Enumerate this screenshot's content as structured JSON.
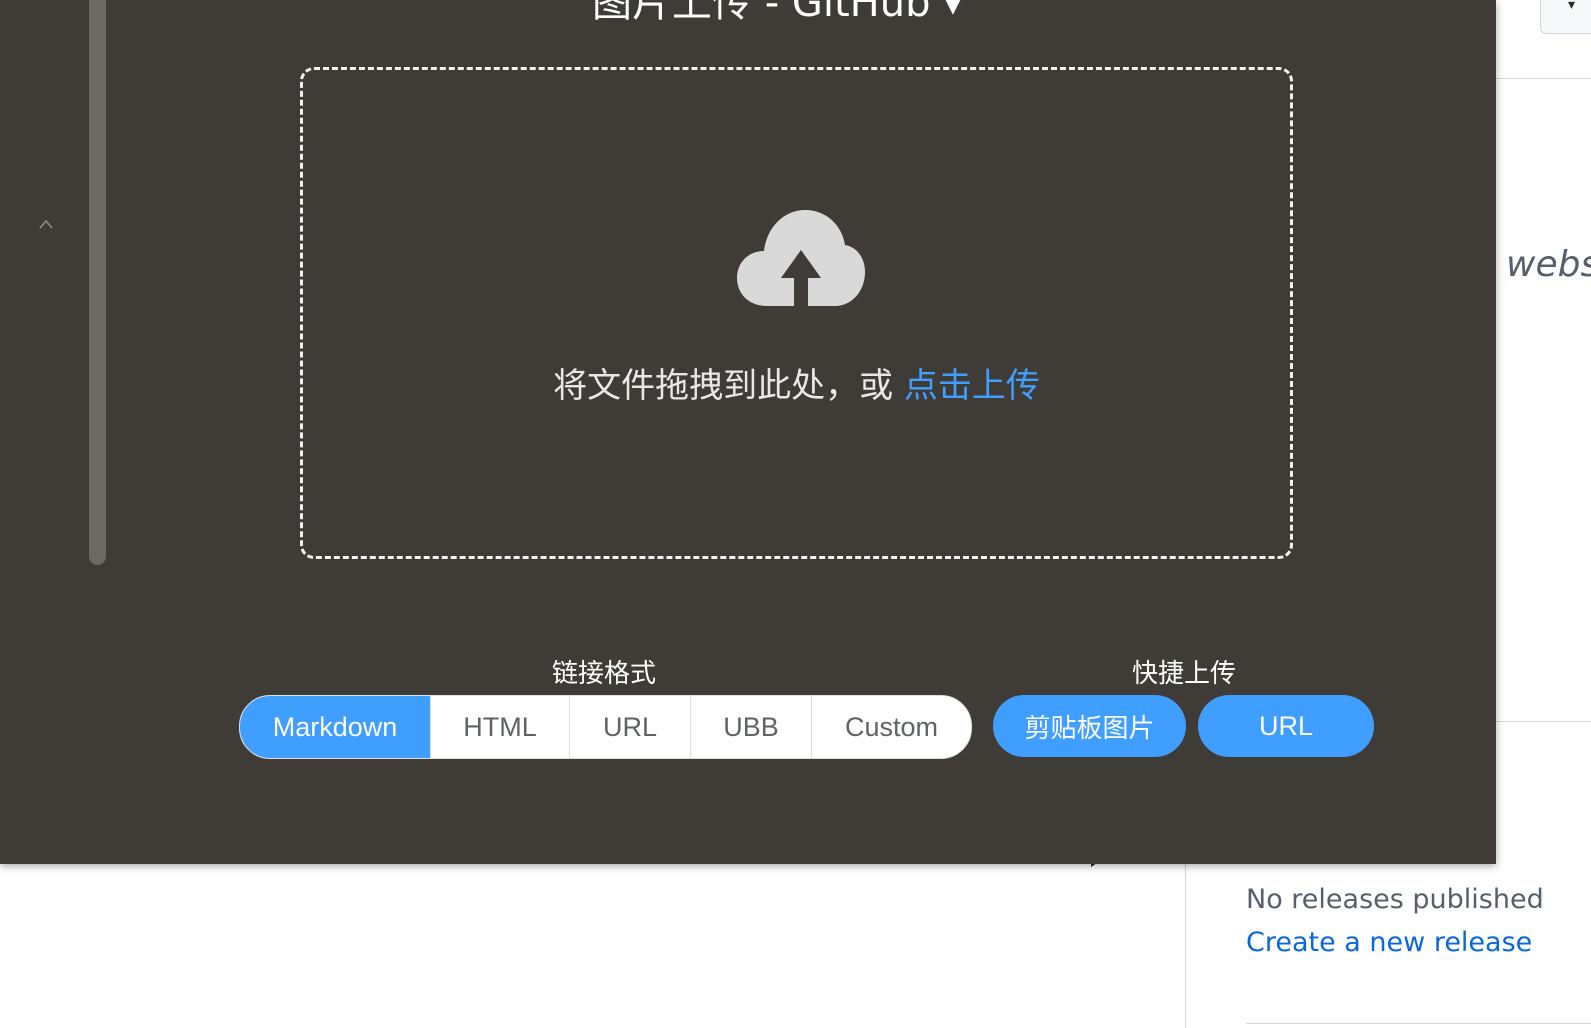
{
  "background": {
    "partial_text": "webs",
    "releases": {
      "empty_text": "No releases published",
      "create_link": "Create a new release"
    }
  },
  "panel": {
    "title": "图片上传 - GitHub",
    "title_caret_icon": "chevron-down-icon",
    "collapse_icon": "chevron-up-icon",
    "drop_zone": {
      "icon": "cloud-upload-icon",
      "hint_text": "将文件拖拽到此处，或 ",
      "hint_link": "点击上传"
    },
    "link_format": {
      "label": "链接格式",
      "options": [
        "Markdown",
        "HTML",
        "URL",
        "UBB",
        "Custom"
      ],
      "selected": "Markdown"
    },
    "quick_upload": {
      "label": "快捷上传",
      "clipboard_button": "剪贴板图片",
      "url_button": "URL"
    }
  },
  "colors": {
    "panel_bg": "#3f3c38",
    "accent": "#409eff",
    "link": "#0969da"
  }
}
